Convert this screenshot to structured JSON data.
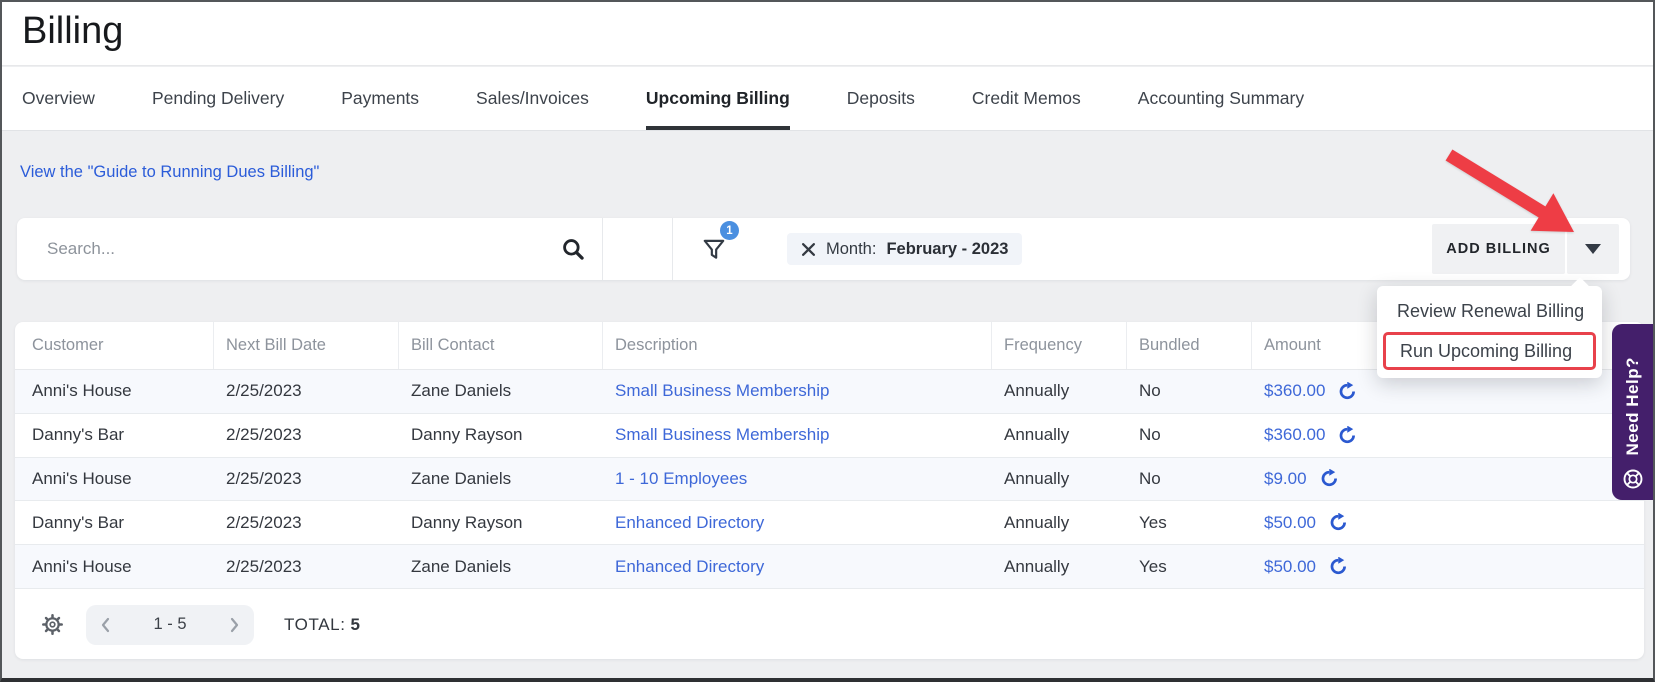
{
  "page": {
    "title": "Billing"
  },
  "tabs": [
    {
      "label": "Overview",
      "active": false
    },
    {
      "label": "Pending Delivery",
      "active": false
    },
    {
      "label": "Payments",
      "active": false
    },
    {
      "label": "Sales/Invoices",
      "active": false
    },
    {
      "label": "Upcoming Billing",
      "active": true
    },
    {
      "label": "Deposits",
      "active": false
    },
    {
      "label": "Credit Memos",
      "active": false
    },
    {
      "label": "Accounting Summary",
      "active": false
    }
  ],
  "guide_link": "View the \"Guide to Running Dues Billing\"",
  "toolbar": {
    "search_placeholder": "Search...",
    "filter_badge": "1",
    "filter_chip": {
      "label": "Month:",
      "value": "February - 2023"
    },
    "add_billing_label": "ADD BILLING",
    "menu_items": [
      "Review Renewal Billing",
      "Run Upcoming Billing"
    ]
  },
  "table": {
    "columns": [
      "Customer",
      "Next Bill Date",
      "Bill Contact",
      "Description",
      "Frequency",
      "Bundled",
      "Amount"
    ],
    "rows": [
      {
        "customer": "Anni's House",
        "next_bill_date": "2/25/2023",
        "bill_contact": "Zane Daniels",
        "description": "Small Business Membership",
        "frequency": "Annually",
        "bundled": "No",
        "amount": "$360.00"
      },
      {
        "customer": "Danny's Bar",
        "next_bill_date": "2/25/2023",
        "bill_contact": "Danny Rayson",
        "description": "Small Business Membership",
        "frequency": "Annually",
        "bundled": "No",
        "amount": "$360.00"
      },
      {
        "customer": "Anni's House",
        "next_bill_date": "2/25/2023",
        "bill_contact": "Zane Daniels",
        "description": "1 - 10 Employees",
        "frequency": "Annually",
        "bundled": "No",
        "amount": "$9.00"
      },
      {
        "customer": "Danny's Bar",
        "next_bill_date": "2/25/2023",
        "bill_contact": "Danny Rayson",
        "description": "Enhanced Directory",
        "frequency": "Annually",
        "bundled": "Yes",
        "amount": "$50.00"
      },
      {
        "customer": "Anni's House",
        "next_bill_date": "2/25/2023",
        "bill_contact": "Zane Daniels",
        "description": "Enhanced Directory",
        "frequency": "Annually",
        "bundled": "Yes",
        "amount": "$50.00"
      }
    ],
    "pagination": {
      "range": "1 - 5",
      "total_label": "TOTAL:",
      "total_value": "5"
    }
  },
  "help_tab": {
    "label": "Need Help?"
  },
  "colors": {
    "link_blue": "#3e68d8",
    "guide_link_blue": "#2b5cd9",
    "badge_blue": "#4a8fe0",
    "annotation_red": "#ee3d45",
    "highlight_red": "#e8414b",
    "help_purple": "#441f6b",
    "row_alt": "#f7f9fd",
    "active_tab_underline": "#2f3338",
    "page_background": "#eeeff1"
  }
}
